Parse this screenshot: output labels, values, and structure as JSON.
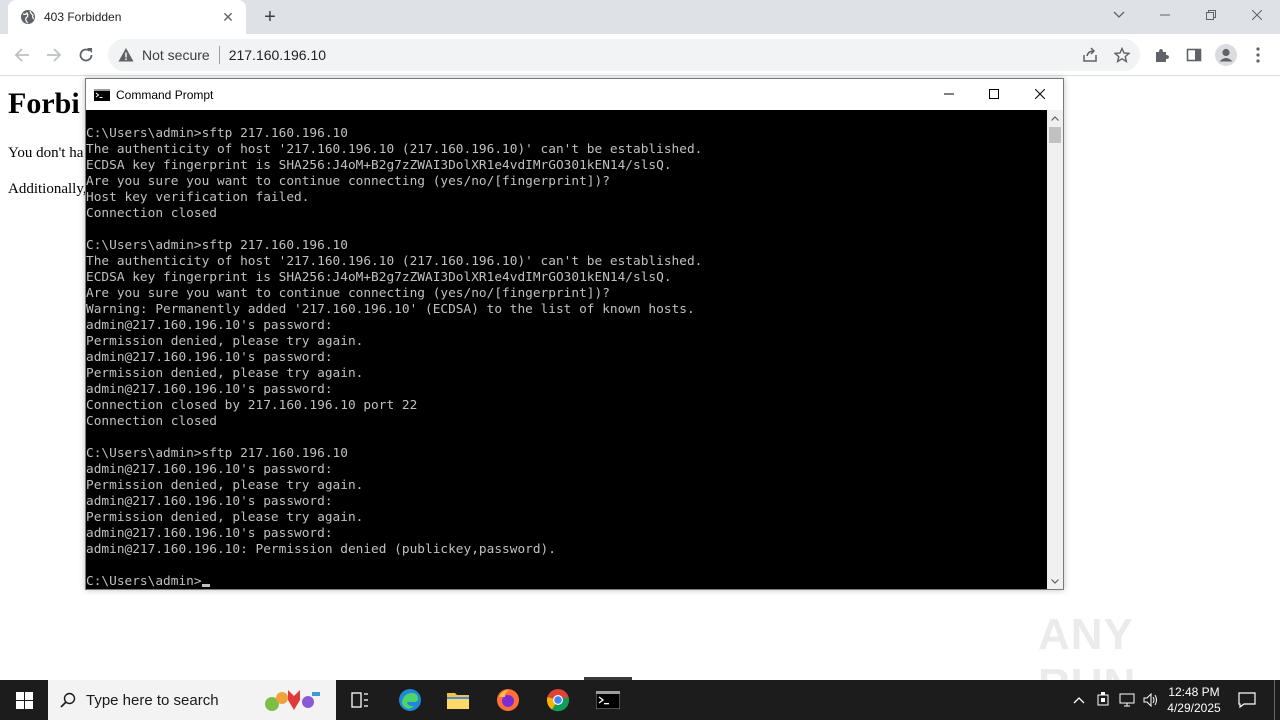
{
  "browser": {
    "tab_title": "403 Forbidden",
    "new_tab_label": "+",
    "omnibox": {
      "security_label": "Not secure",
      "url": "217.160.196.10"
    }
  },
  "page": {
    "heading": "Forbi",
    "line1": "You don't ha",
    "line2": "Additionally,"
  },
  "cmd": {
    "title": "Command Prompt",
    "lines": [
      "C:\\Users\\admin>sftp 217.160.196.10",
      "The authenticity of host '217.160.196.10 (217.160.196.10)' can't be established.",
      "ECDSA key fingerprint is SHA256:J4oM+B2g7zZWAI3DolXR1e4vdIMrGO301kEN14/slsQ.",
      "Are you sure you want to continue connecting (yes/no/[fingerprint])?",
      "Host key verification failed.",
      "Connection closed",
      "",
      "C:\\Users\\admin>sftp 217.160.196.10",
      "The authenticity of host '217.160.196.10 (217.160.196.10)' can't be established.",
      "ECDSA key fingerprint is SHA256:J4oM+B2g7zZWAI3DolXR1e4vdIMrGO301kEN14/slsQ.",
      "Are you sure you want to continue connecting (yes/no/[fingerprint])?",
      "Warning: Permanently added '217.160.196.10' (ECDSA) to the list of known hosts.",
      "admin@217.160.196.10's password:",
      "Permission denied, please try again.",
      "admin@217.160.196.10's password:",
      "Permission denied, please try again.",
      "admin@217.160.196.10's password:",
      "Connection closed by 217.160.196.10 port 22",
      "Connection closed",
      "",
      "C:\\Users\\admin>sftp 217.160.196.10",
      "admin@217.160.196.10's password:",
      "Permission denied, please try again.",
      "admin@217.160.196.10's password:",
      "Permission denied, please try again.",
      "admin@217.160.196.10's password:",
      "admin@217.160.196.10: Permission denied (publickey,password).",
      "",
      "C:\\Users\\admin>"
    ]
  },
  "watermark": {
    "text": "ANY RUN"
  },
  "taskbar": {
    "search_placeholder": "Type here to search",
    "time": "12:48 PM",
    "date": "4/29/2025"
  },
  "icons": {
    "tab": "globe-icon",
    "omnibox": "warning-triangle-icon",
    "colors": {
      "tabstrip": "#dee1e6",
      "console_bg": "#000000",
      "console_fg": "#c0c0c0",
      "taskbar": "#1c1c1c"
    }
  }
}
